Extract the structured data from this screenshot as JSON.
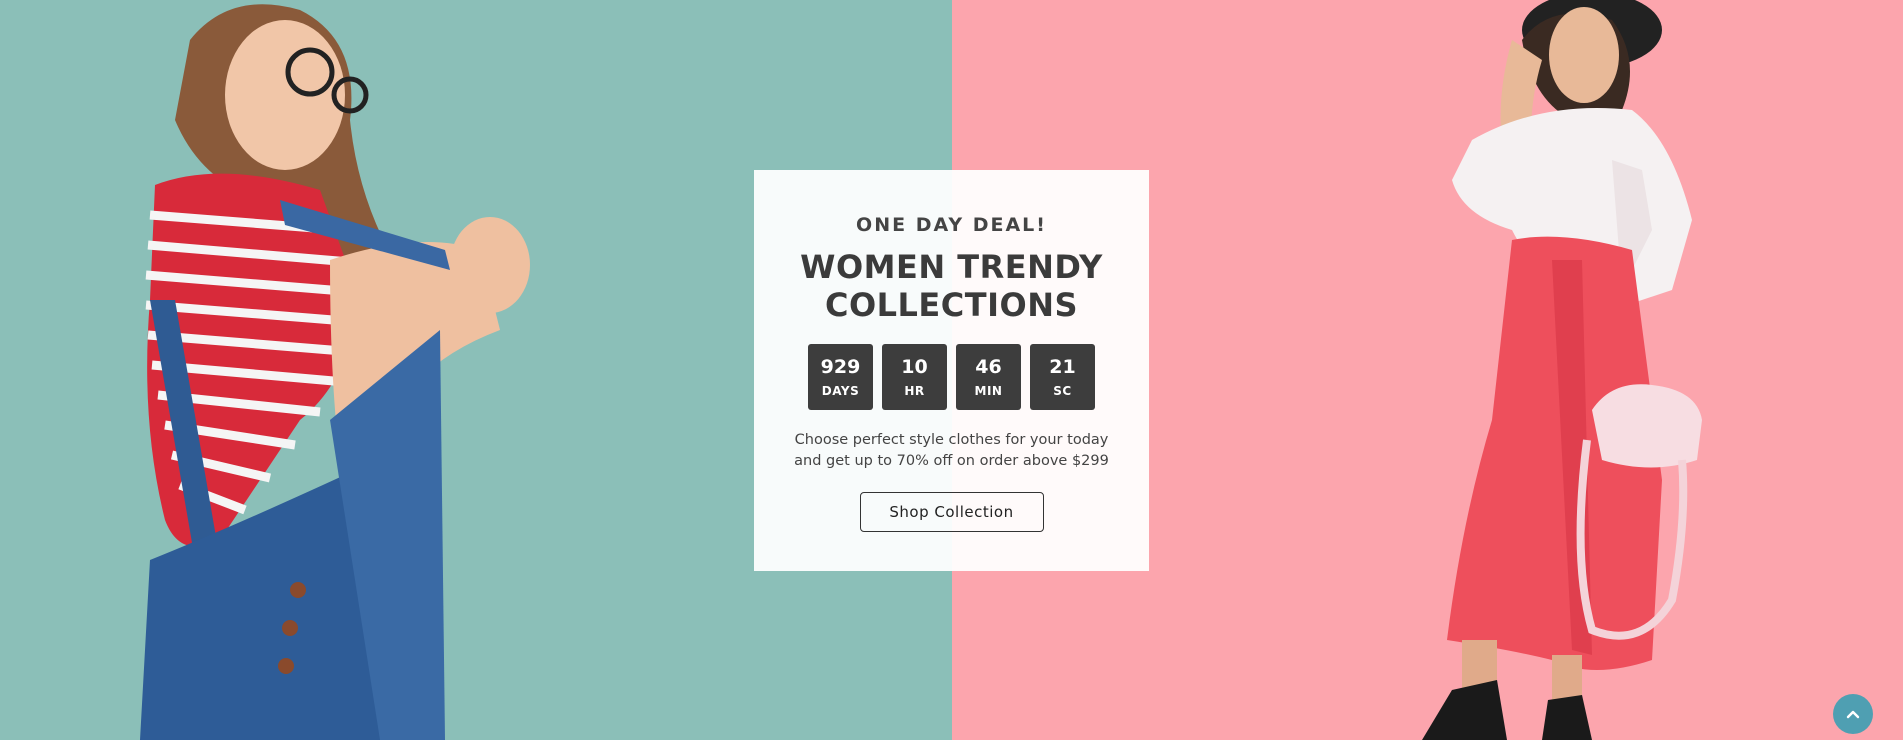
{
  "hero": {
    "left_bg": "#8bbfb8",
    "right_bg": "#fca5ad"
  },
  "deal": {
    "eyebrow": "ONE DAY DEAL!",
    "title_line1": "WOMEN TRENDY",
    "title_line2": "COLLECTIONS",
    "countdown": [
      {
        "value": "929",
        "unit": "DAYS"
      },
      {
        "value": "10",
        "unit": "HR"
      },
      {
        "value": "46",
        "unit": "MIN"
      },
      {
        "value": "21",
        "unit": "SC"
      }
    ],
    "description_line1": "Choose perfect style clothes for your today",
    "description_line2": "and get up to 70% off on order above $299",
    "button_label": "Shop Collection"
  },
  "scroll_top": {
    "icon": "chevron-up-icon",
    "color": "#4f9fb2"
  }
}
